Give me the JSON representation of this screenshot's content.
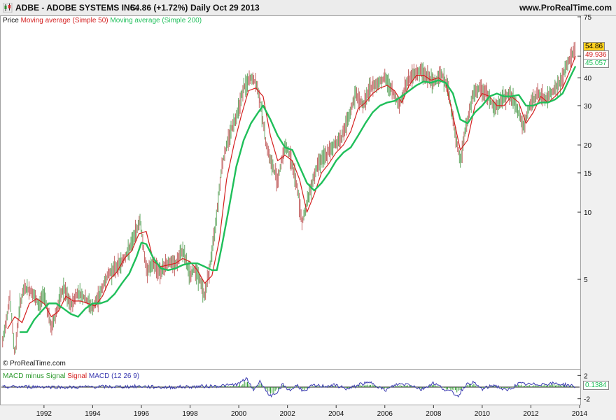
{
  "header": {
    "ticker": "ADBE - ADOBE SYSTEMS INC.",
    "price": "54.86 (+1.72%)",
    "period": "Daily  Oct 29 2013",
    "site": "www.ProRealTime.com"
  },
  "legend": {
    "price": "Price",
    "ma50": "Moving average (Simple 50)",
    "ma200": "Moving average (Simple 200)"
  },
  "macd_legend": {
    "hist": "MACD minus Signal",
    "signal": "Signal",
    "macd": "MACD (12 26 9)"
  },
  "watermark": "© ProRealTime.com",
  "value_boxes": {
    "price": "54.86",
    "ma50": "49.936",
    "ma200": "45.057",
    "macd": "0.1384"
  },
  "colors": {
    "ma50": "#d42020",
    "ma200": "#1fbf5a",
    "bars": "#2e8a2e",
    "macd": "#3a3ab0",
    "price_box": "#ffd21f"
  },
  "chart_data": [
    {
      "type": "line",
      "scale": "log",
      "ylim": [
        2,
        75
      ],
      "y_ticks": [
        "75",
        "50",
        "40",
        "30",
        "20",
        "15",
        "10",
        "5"
      ],
      "x_ticks": [
        "1992",
        "1994",
        "1996",
        "1998",
        "2000",
        "2002",
        "2004",
        "2006",
        "2008",
        "2010",
        "2012",
        "2014"
      ],
      "xlim": [
        1990.25,
        2014.0
      ],
      "series": [
        {
          "name": "Price",
          "x": [
            1990.3,
            1990.6,
            1990.8,
            1991.0,
            1991.2,
            1991.5,
            1991.8,
            1992.0,
            1992.3,
            1992.6,
            1992.8,
            1993.1,
            1993.4,
            1993.7,
            1994.0,
            1994.3,
            1994.6,
            1994.9,
            1995.2,
            1995.5,
            1995.8,
            1995.95,
            1996.2,
            1996.5,
            1996.8,
            1997.1,
            1997.4,
            1997.7,
            1998.0,
            1998.2,
            1998.4,
            1998.6,
            1998.8,
            1999.0,
            1999.3,
            1999.6,
            1999.9,
            2000.2,
            2000.5,
            2000.7,
            2000.9,
            2001.1,
            2001.3,
            2001.6,
            2001.9,
            2002.1,
            2002.4,
            2002.6,
            2002.8,
            2003.0,
            2003.3,
            2003.6,
            2003.9,
            2004.2,
            2004.5,
            2004.8,
            2005.1,
            2005.4,
            2005.7,
            2006.0,
            2006.3,
            2006.6,
            2006.9,
            2007.2,
            2007.5,
            2007.8,
            2008.0,
            2008.3,
            2008.6,
            2008.9,
            2009.1,
            2009.3,
            2009.6,
            2009.9,
            2010.2,
            2010.5,
            2010.8,
            2011.1,
            2011.4,
            2011.7,
            2012.0,
            2012.3,
            2012.6,
            2012.9,
            2013.2,
            2013.5,
            2013.83
          ],
          "values": [
            2.6,
            4.2,
            2.3,
            3.8,
            4.6,
            4.4,
            3.8,
            4.4,
            3.0,
            3.9,
            4.6,
            3.8,
            4.4,
            4.1,
            3.7,
            4.3,
            5.2,
            5.6,
            6.0,
            6.8,
            8.3,
            9.3,
            5.5,
            5.8,
            5.4,
            6.0,
            5.8,
            6.8,
            5.2,
            5.6,
            5.0,
            4.2,
            5.6,
            8.0,
            16.0,
            22.0,
            27.0,
            36.0,
            40.0,
            38.0,
            31.0,
            21.0,
            17.0,
            14.0,
            20.0,
            18.0,
            13.0,
            9.0,
            11.0,
            13.5,
            17.0,
            18.0,
            20.0,
            21.5,
            26.0,
            34.0,
            30.0,
            36.0,
            38.0,
            40.0,
            35.0,
            30.0,
            38.0,
            42.0,
            43.0,
            40.0,
            38.0,
            42.0,
            36.0,
            22.0,
            17.0,
            23.0,
            33.0,
            36.0,
            34.0,
            29.0,
            32.0,
            34.0,
            30.0,
            24.0,
            31.0,
            34.0,
            32.0,
            35.0,
            38.0,
            46.0,
            54.86
          ]
        },
        {
          "name": "Moving average (Simple 50)",
          "x": [
            1990.5,
            1990.8,
            1991.1,
            1991.4,
            1991.7,
            1992.0,
            1992.3,
            1992.6,
            1992.9,
            1993.2,
            1993.5,
            1993.8,
            1994.1,
            1994.4,
            1994.7,
            1995.0,
            1995.3,
            1995.6,
            1995.9,
            1996.2,
            1996.5,
            1996.8,
            1997.1,
            1997.4,
            1997.7,
            1998.0,
            1998.3,
            1998.6,
            1998.9,
            1999.2,
            1999.5,
            1999.8,
            2000.1,
            2000.4,
            2000.7,
            2001.0,
            2001.3,
            2001.6,
            2001.9,
            2002.2,
            2002.5,
            2002.8,
            2003.1,
            2003.4,
            2003.7,
            2004.0,
            2004.3,
            2004.6,
            2004.9,
            2005.2,
            2005.5,
            2005.8,
            2006.1,
            2006.4,
            2006.7,
            2007.0,
            2007.3,
            2007.6,
            2007.9,
            2008.2,
            2008.5,
            2008.8,
            2009.1,
            2009.4,
            2009.7,
            2010.0,
            2010.3,
            2010.6,
            2010.9,
            2011.2,
            2011.5,
            2011.8,
            2012.1,
            2012.4,
            2012.7,
            2013.0,
            2013.3,
            2013.6,
            2013.83
          ],
          "values": [
            3.0,
            3.4,
            3.2,
            3.9,
            4.1,
            3.9,
            3.4,
            3.6,
            4.2,
            4.0,
            4.0,
            3.9,
            3.8,
            4.2,
            5.0,
            5.4,
            6.2,
            6.7,
            8.0,
            8.2,
            6.0,
            5.7,
            5.8,
            5.9,
            6.2,
            6.0,
            5.5,
            4.8,
            5.2,
            7.5,
            14.0,
            20.0,
            27.0,
            35.0,
            36.0,
            33.0,
            22.0,
            17.0,
            18.0,
            17.0,
            14.0,
            10.0,
            12.0,
            15.0,
            16.5,
            18.5,
            20.0,
            23.0,
            29.0,
            31.0,
            34.0,
            36.0,
            37.0,
            35.0,
            31.0,
            37.0,
            41.0,
            41.0,
            39.0,
            40.0,
            38.0,
            27.0,
            19.0,
            21.0,
            30.0,
            34.0,
            33.0,
            30.0,
            30.0,
            33.0,
            31.0,
            25.0,
            28.0,
            33.0,
            31.0,
            33.0,
            36.0,
            43.0,
            49.936
          ]
        },
        {
          "name": "Moving average (Simple 200)",
          "x": [
            1991.0,
            1991.3,
            1991.6,
            1991.9,
            1992.2,
            1992.5,
            1992.8,
            1993.1,
            1993.4,
            1993.7,
            1994.0,
            1994.3,
            1994.6,
            1994.9,
            1995.2,
            1995.5,
            1995.8,
            1996.0,
            1996.2,
            1996.5,
            1996.8,
            1997.1,
            1997.4,
            1997.7,
            1998.0,
            1998.3,
            1998.6,
            1998.9,
            1999.1,
            1999.3,
            1999.6,
            1999.9,
            2000.2,
            2000.5,
            2000.8,
            2001.0,
            2001.3,
            2001.6,
            2001.9,
            2002.2,
            2002.5,
            2002.8,
            2003.1,
            2003.4,
            2003.7,
            2004.0,
            2004.3,
            2004.6,
            2004.9,
            2005.2,
            2005.5,
            2005.8,
            2006.1,
            2006.4,
            2006.7,
            2007.0,
            2007.3,
            2007.6,
            2007.9,
            2008.2,
            2008.5,
            2008.8,
            2009.1,
            2009.4,
            2009.7,
            2010.0,
            2010.3,
            2010.6,
            2010.9,
            2011.2,
            2011.5,
            2011.8,
            2012.1,
            2012.4,
            2012.7,
            2013.0,
            2013.3,
            2013.6,
            2013.83
          ],
          "values": [
            2.9,
            2.9,
            3.3,
            3.6,
            3.9,
            3.9,
            3.7,
            3.5,
            3.4,
            3.7,
            3.9,
            3.9,
            4.0,
            4.3,
            4.8,
            5.3,
            6.3,
            7.3,
            7.2,
            6.2,
            5.6,
            5.5,
            5.6,
            5.8,
            5.9,
            5.9,
            5.7,
            5.5,
            5.5,
            7.0,
            10.5,
            16.0,
            21.0,
            25.0,
            28.0,
            30.0,
            26.0,
            22.0,
            19.5,
            19.0,
            16.0,
            13.5,
            12.5,
            13.5,
            15.0,
            17.0,
            18.5,
            19.5,
            22.0,
            25.0,
            28.0,
            30.0,
            31.0,
            31.5,
            33.0,
            35.0,
            37.0,
            38.5,
            38.0,
            39.0,
            38.0,
            34.0,
            26.0,
            25.0,
            28.0,
            30.0,
            33.0,
            34.0,
            33.0,
            33.0,
            33.5,
            30.0,
            30.0,
            31.0,
            31.0,
            32.0,
            34.0,
            40.0,
            45.057
          ]
        }
      ]
    },
    {
      "type": "line",
      "title": "MACD (12 26 9)",
      "y_ticks": [
        "2",
        "-2"
      ],
      "ylim": [
        -3,
        3
      ],
      "series": [
        {
          "name": "MACD (12 26 9)",
          "x": [
            1990.3,
            1991.0,
            1992.0,
            1993.0,
            1994.0,
            1995.0,
            1996.0,
            1997.0,
            1998.0,
            1999.0,
            1999.6,
            2000.0,
            2000.3,
            2000.6,
            2000.9,
            2001.2,
            2001.5,
            2001.8,
            2002.1,
            2002.4,
            2002.7,
            2003.0,
            2003.5,
            2004.0,
            2004.5,
            2005.0,
            2005.5,
            2006.0,
            2006.5,
            2007.0,
            2007.5,
            2008.0,
            2008.5,
            2008.8,
            2009.0,
            2009.3,
            2009.6,
            2010.0,
            2010.5,
            2011.0,
            2011.5,
            2012.0,
            2012.5,
            2013.0,
            2013.5,
            2013.83
          ],
          "values": [
            0.0,
            0.1,
            0.1,
            -0.1,
            0.1,
            0.1,
            0.2,
            -0.1,
            0.1,
            0.3,
            0.5,
            0.9,
            2.5,
            -0.8,
            1.8,
            -2.0,
            -2.6,
            0.8,
            -1.0,
            0.6,
            -1.5,
            0.4,
            0.3,
            0.5,
            -0.6,
            0.9,
            1.2,
            -1.0,
            0.8,
            0.9,
            -0.7,
            1.2,
            -0.8,
            -1.6,
            -2.6,
            0.5,
            1.4,
            -0.6,
            0.6,
            -1.1,
            1.0,
            0.7,
            0.9,
            1.0,
            0.6,
            0.1384
          ]
        }
      ]
    }
  ]
}
